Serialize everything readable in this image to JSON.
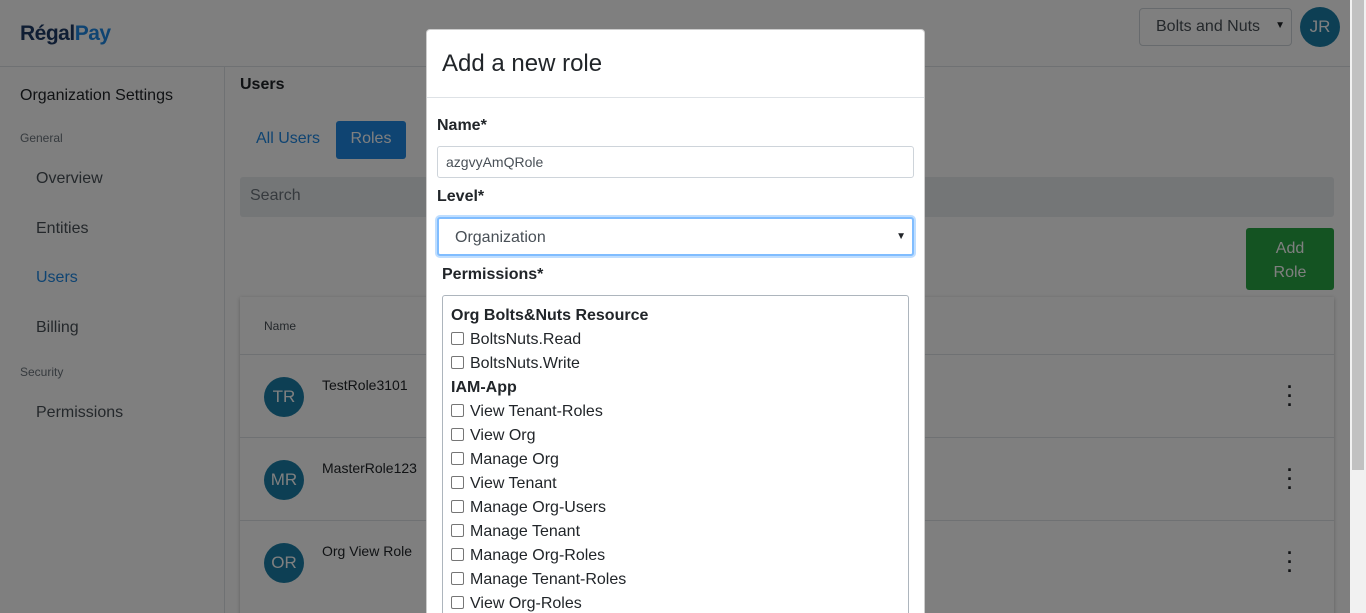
{
  "app": {
    "logo_regal": "Régal",
    "logo_pay": "Pay",
    "org_selector": "Bolts and Nuts",
    "user_initials": "JR"
  },
  "sidebar": {
    "title": "Organization Settings",
    "section_general": "General",
    "section_security": "Security",
    "items": [
      {
        "label": "Overview"
      },
      {
        "label": "Entities"
      },
      {
        "label": "Users"
      },
      {
        "label": "Billing"
      },
      {
        "label": "Permissions"
      }
    ]
  },
  "main": {
    "title": "Users",
    "tabs": [
      {
        "label": "All Users"
      },
      {
        "label": "Roles"
      }
    ],
    "search_placeholder": "Search",
    "add_role_line1": "Add",
    "add_role_line2": "Role",
    "table_header": "Name",
    "rows": [
      {
        "initials": "TR",
        "name": "TestRole3101"
      },
      {
        "initials": "MR",
        "name": "MasterRole123"
      },
      {
        "initials": "OR",
        "name": "Org View Role"
      }
    ]
  },
  "modal": {
    "title": "Add a new role",
    "name_label": "Name*",
    "name_value": "azgvyAmQRole",
    "level_label": "Level*",
    "level_value": "Organization",
    "permissions_label": "Permissions*",
    "groups": [
      {
        "name": "Org Bolts&Nuts Resource",
        "permissions": [
          "BoltsNuts.Read",
          "BoltsNuts.Write"
        ]
      },
      {
        "name": "IAM-App",
        "permissions": [
          "View Tenant-Roles",
          "View Org",
          "Manage Org",
          "View Tenant",
          "Manage Org-Users",
          "Manage Tenant",
          "Manage Org-Roles",
          "Manage Tenant-Roles",
          "View Org-Roles"
        ]
      }
    ]
  },
  "colors": {
    "primary": "#1e88e5",
    "success": "#28a745",
    "avatar": "#1a7fa8"
  }
}
